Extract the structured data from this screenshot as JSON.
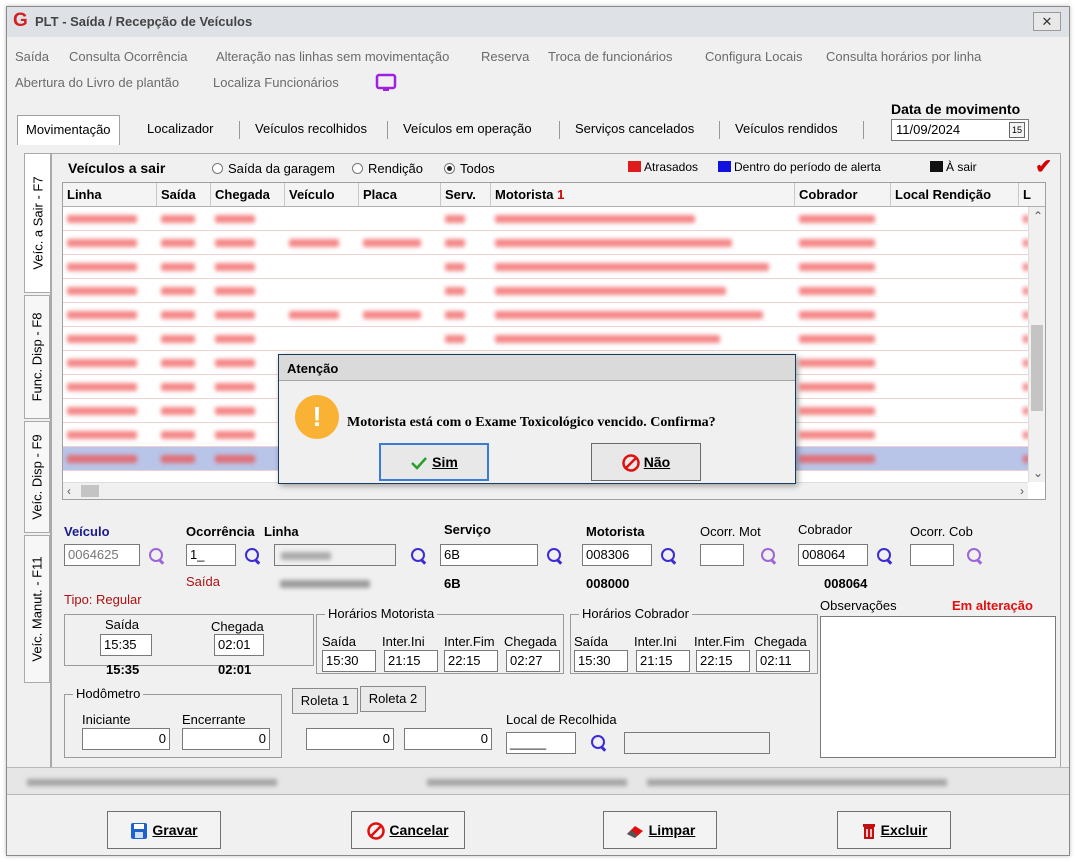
{
  "window": {
    "title": "PLT - Saída / Recepção de Veículos",
    "close_icon": "✕"
  },
  "menu": [
    "Saída",
    "Consulta Ocorrência",
    "Alteração nas linhas sem movimentação",
    "Reserva",
    "Troca de funcionários",
    "Configura Locais",
    "Consulta horários por linha",
    "Abertura do Livro de plantão",
    "Localiza Funcionários"
  ],
  "tabs": [
    "Movimentação",
    "Localizador",
    "Veículos recolhidos",
    "Veículos em operação",
    "Serviços cancelados",
    "Veículos rendidos"
  ],
  "date": {
    "label": "Data de movimento",
    "value": "11/09/2024",
    "button": "15"
  },
  "side_tabs": [
    "Veíc. a Sair - F7",
    "Func. Disp - F8",
    "Veíc. Disp - F9",
    "Veíc. Manut. - F11"
  ],
  "grid": {
    "title": "Veículos a sair",
    "radio": {
      "garagem": "Saída da garagem",
      "rendicao": "Rendição",
      "todos": "Todos"
    },
    "legend": {
      "atrasados": "Atrasados",
      "alerta": "Dentro do período de alerta",
      "sair": "À sair"
    },
    "colors": {
      "atrasados": "#e01b1b",
      "alerta": "#1212e0",
      "sair": "#111111",
      "row_text": "#f26a6a",
      "selected": "#b8c4e8"
    },
    "columns": [
      "Linha",
      "Saída",
      "Chegada",
      "Veículo",
      "Placa",
      "Serv.",
      "Motorista",
      "Cobrador",
      "Local Rendição",
      "L"
    ],
    "sort_icon": "1"
  },
  "form": {
    "veiculo_label": "Veículo",
    "veiculo_value": "0064625",
    "ocorrencia_label": "Ocorrência",
    "ocorrencia_value": "1_",
    "linha_label": "Linha",
    "saida_caption": "Saída",
    "servico_label": "Serviço",
    "servico_value": "6B",
    "servico_caption": "6B",
    "motorista_label": "Motorista",
    "motorista_value": "008306",
    "motorista_caption": "008000",
    "ocorr_mot_label": "Ocorr. Mot",
    "cobrador_label": "Cobrador",
    "cobrador_value": "008064",
    "cobrador_caption": "008064",
    "ocorr_cob_label": "Ocorr. Cob",
    "tipo": "Tipo: Regular",
    "saida_label": "Saída",
    "saida_value": "15:35",
    "saida_caption2": "15:35",
    "chegada_label": "Chegada",
    "chegada_value": "02:01",
    "chegada_caption": "02:01",
    "hor_mot": {
      "title": "Horários Motorista",
      "saida": "15:30",
      "inter_ini": "21:15",
      "inter_fim": "22:15",
      "chegada": "02:27"
    },
    "hor_cob": {
      "title": "Horários Cobrador",
      "saida": "15:30",
      "inter_ini": "21:15",
      "inter_fim": "22:15",
      "chegada": "02:11"
    },
    "col": {
      "saida": "Saída",
      "inter_ini": "Inter.Ini",
      "inter_fim": "Inter.Fim",
      "chegada": "Chegada"
    },
    "observacoes_label": "Observações",
    "em_alteracao": "Em alteração",
    "hodometro": {
      "title": "Hodômetro",
      "iniciante_label": "Iniciante",
      "iniciante": "0",
      "encerrante_label": "Encerrante",
      "encerrante": "0"
    },
    "roleta1": "Roleta 1",
    "roleta2": "Roleta 2",
    "roleta1_value": "0",
    "roleta2_value": "0",
    "local_recolhida_label": "Local de Recolhida",
    "local_recolhida_value": "_____"
  },
  "buttons": {
    "gravar": "Gravar",
    "cancelar": "Cancelar",
    "limpar": "Limpar",
    "excluir": "Excluir"
  },
  "dialog": {
    "title": "Atenção",
    "icon": "!",
    "message": "Motorista está com o Exame Toxicológico vencido. Confirma?",
    "sim": "Sim",
    "nao": "Não"
  }
}
